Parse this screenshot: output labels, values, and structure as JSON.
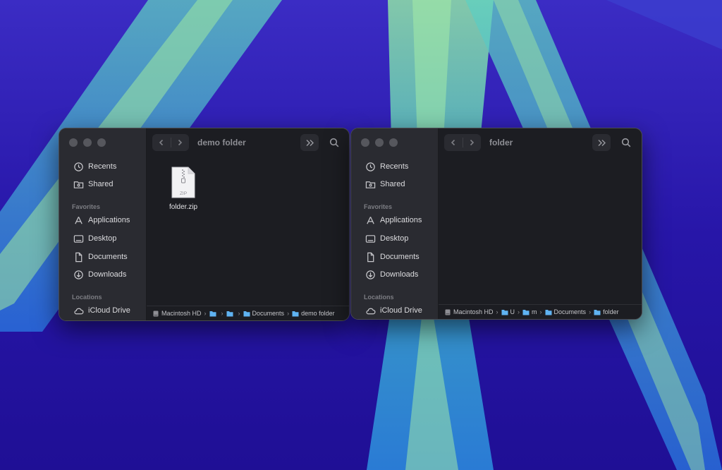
{
  "colors": {
    "window_bg": "#1c1d22",
    "sidebar_bg": "#2a2b31",
    "folder_blue": "#5fb3f2",
    "wallpaper_dark": "#2a1aa8",
    "wallpaper_light": "#73d6a8"
  },
  "sidebar": {
    "recents": "Recents",
    "shared": "Shared",
    "favorites_header": "Favorites",
    "applications": "Applications",
    "desktop": "Desktop",
    "documents": "Documents",
    "downloads": "Downloads",
    "locations_header": "Locations",
    "icloud": "iCloud Drive"
  },
  "left_window": {
    "title": "demo folder",
    "file": {
      "name": "folder.zip",
      "badge": "ZIP",
      "icon": "zip-archive-icon"
    },
    "path": {
      "root": "Macintosh HD",
      "documents": "Documents",
      "current": "demo folder"
    }
  },
  "right_window": {
    "title": "folder",
    "path": {
      "root": "Macintosh HD",
      "users_trunc": "U",
      "user_trunc": "m",
      "documents": "Documents",
      "current": "folder"
    }
  }
}
